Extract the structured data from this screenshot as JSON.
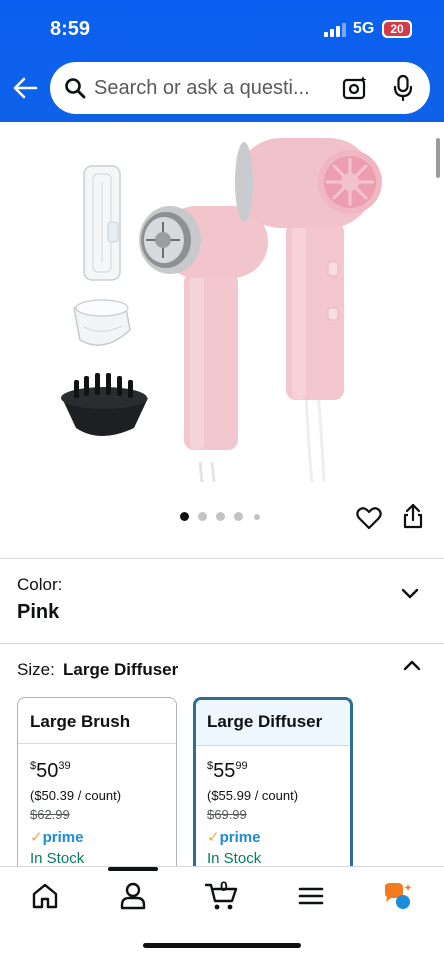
{
  "status_bar": {
    "time": "8:59",
    "network": "5G",
    "battery": "20"
  },
  "search": {
    "placeholder": "Search or ask a questi..."
  },
  "gallery": {
    "image_count": 5,
    "active_index": 0
  },
  "color": {
    "label": "Color:",
    "value": "Pink"
  },
  "size": {
    "label": "Size:",
    "value": "Large Diffuser"
  },
  "options": [
    {
      "title": "Large Brush",
      "price_whole": "50",
      "price_fraction": "39",
      "currency": "$",
      "unit_price": "($50.39 / count)",
      "list_price": "$62.99",
      "prime": "prime",
      "stock": "In Stock",
      "selected": false
    },
    {
      "title": "Large Diffuser",
      "price_whole": "55",
      "price_fraction": "99",
      "currency": "$",
      "unit_price": "($55.99 / count)",
      "list_price": "$69.99",
      "prime": "prime",
      "stock": "In Stock",
      "selected": true
    }
  ],
  "bottom_nav": {
    "cart_count": "0",
    "active": "account"
  },
  "colors": {
    "header": "#0f62e8",
    "selected_border": "#2d6d8f",
    "prime": "#1a8cd8",
    "stock": "#067d62"
  }
}
